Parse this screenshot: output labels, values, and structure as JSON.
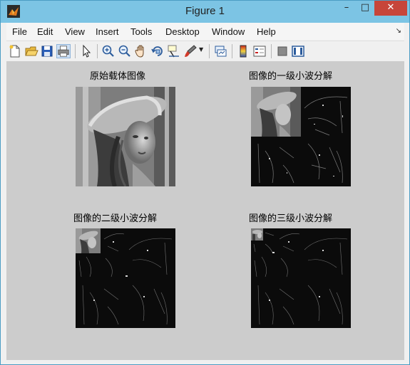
{
  "window": {
    "title": "Figure 1",
    "buttons": {
      "minimize": "–",
      "maximize": "□",
      "close": "✕"
    }
  },
  "menu": [
    "File",
    "Edit",
    "View",
    "Insert",
    "Tools",
    "Desktop",
    "Window",
    "Help"
  ],
  "toolbar": [
    "new-figure",
    "open-file",
    "save",
    "print",
    "edit-plot",
    "zoom-in",
    "zoom-out",
    "pan",
    "rotate-3d",
    "data-cursor",
    "brush",
    "link-plot",
    "colorbar",
    "legend",
    "hide-plot-tools",
    "show-plot-tools"
  ],
  "panels": [
    {
      "title": "原始载体图像",
      "level": 0
    },
    {
      "title": "图像的一级小波分解",
      "level": 1
    },
    {
      "title": "图像的二级小波分解",
      "level": 2
    },
    {
      "title": "图像的三级小波分解",
      "level": 3
    }
  ]
}
